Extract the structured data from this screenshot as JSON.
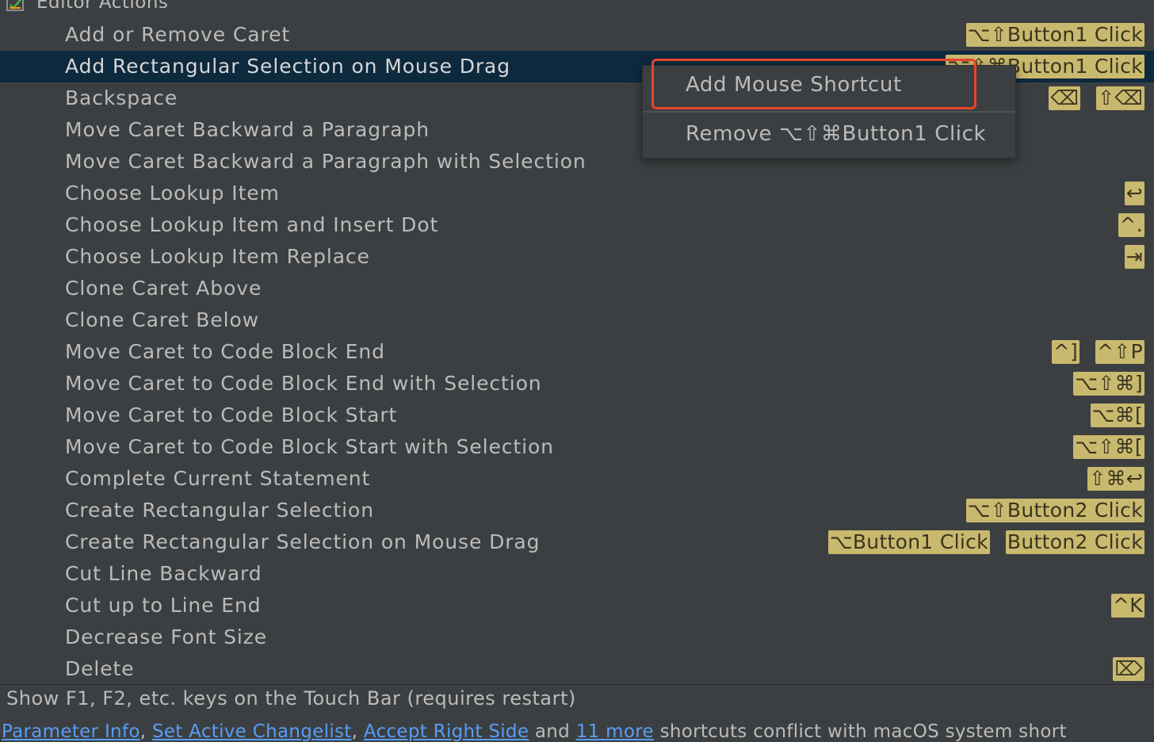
{
  "group": {
    "label": "Editor Actions",
    "icon": "editor-actions-icon"
  },
  "rows": [
    {
      "label": "Add or Remove Caret",
      "shortcuts": [
        "⌥⇧Button1 Click"
      ]
    },
    {
      "label": "Add Rectangular Selection on Mouse Drag",
      "shortcuts": [
        "⌥⇧⌘Button1 Click"
      ],
      "selected": true
    },
    {
      "label": "Backspace",
      "shortcuts": [
        "⌫",
        "⇧⌫"
      ]
    },
    {
      "label": "Move Caret Backward a Paragraph",
      "shortcuts": []
    },
    {
      "label": "Move Caret Backward a Paragraph with Selection",
      "shortcuts": []
    },
    {
      "label": "Choose Lookup Item",
      "shortcuts": [
        "↩"
      ]
    },
    {
      "label": "Choose Lookup Item and Insert Dot",
      "shortcuts": [
        "^."
      ]
    },
    {
      "label": "Choose Lookup Item Replace",
      "shortcuts": [
        "⇥"
      ]
    },
    {
      "label": "Clone Caret Above",
      "shortcuts": []
    },
    {
      "label": "Clone Caret Below",
      "shortcuts": []
    },
    {
      "label": "Move Caret to Code Block End",
      "shortcuts": [
        "^]",
        "^⇧P"
      ]
    },
    {
      "label": "Move Caret to Code Block End with Selection",
      "shortcuts": [
        "⌥⇧⌘]"
      ]
    },
    {
      "label": "Move Caret to Code Block Start",
      "shortcuts": [
        "⌥⌘["
      ]
    },
    {
      "label": "Move Caret to Code Block Start with Selection",
      "shortcuts": [
        "⌥⇧⌘["
      ]
    },
    {
      "label": "Complete Current Statement",
      "shortcuts": [
        "⇧⌘↩"
      ]
    },
    {
      "label": "Create Rectangular Selection",
      "shortcuts": [
        "⌥⇧Button2 Click"
      ]
    },
    {
      "label": "Create Rectangular Selection on Mouse Drag",
      "shortcuts": [
        "⌥Button1 Click",
        "Button2 Click"
      ]
    },
    {
      "label": "Cut Line Backward",
      "shortcuts": []
    },
    {
      "label": "Cut up to Line End",
      "shortcuts": [
        "^K"
      ]
    },
    {
      "label": "Decrease Font Size",
      "shortcuts": []
    },
    {
      "label": "Delete",
      "shortcuts": [
        "⌦"
      ]
    }
  ],
  "context_menu": {
    "add_label": "Add Mouse Shortcut",
    "remove_label": "Remove ⌥⇧⌘Button1 Click"
  },
  "footer": {
    "touchbar_text": "Show F1, F2, etc. keys on the Touch Bar (requires restart)",
    "conflict": {
      "link1": "Parameter Info",
      "sep1": ", ",
      "link2": "Set Active Changelist",
      "sep2": ", ",
      "link3": "Accept Right Side",
      "and_text": " and ",
      "link4": "11 more",
      "tail": " shortcuts conflict with macOS system short"
    }
  },
  "colors": {
    "background": "#3c3f41",
    "selection": "#0d293e",
    "shortcut_chip": "#c9b96e",
    "link": "#589df6",
    "highlight": "#e8442a"
  }
}
